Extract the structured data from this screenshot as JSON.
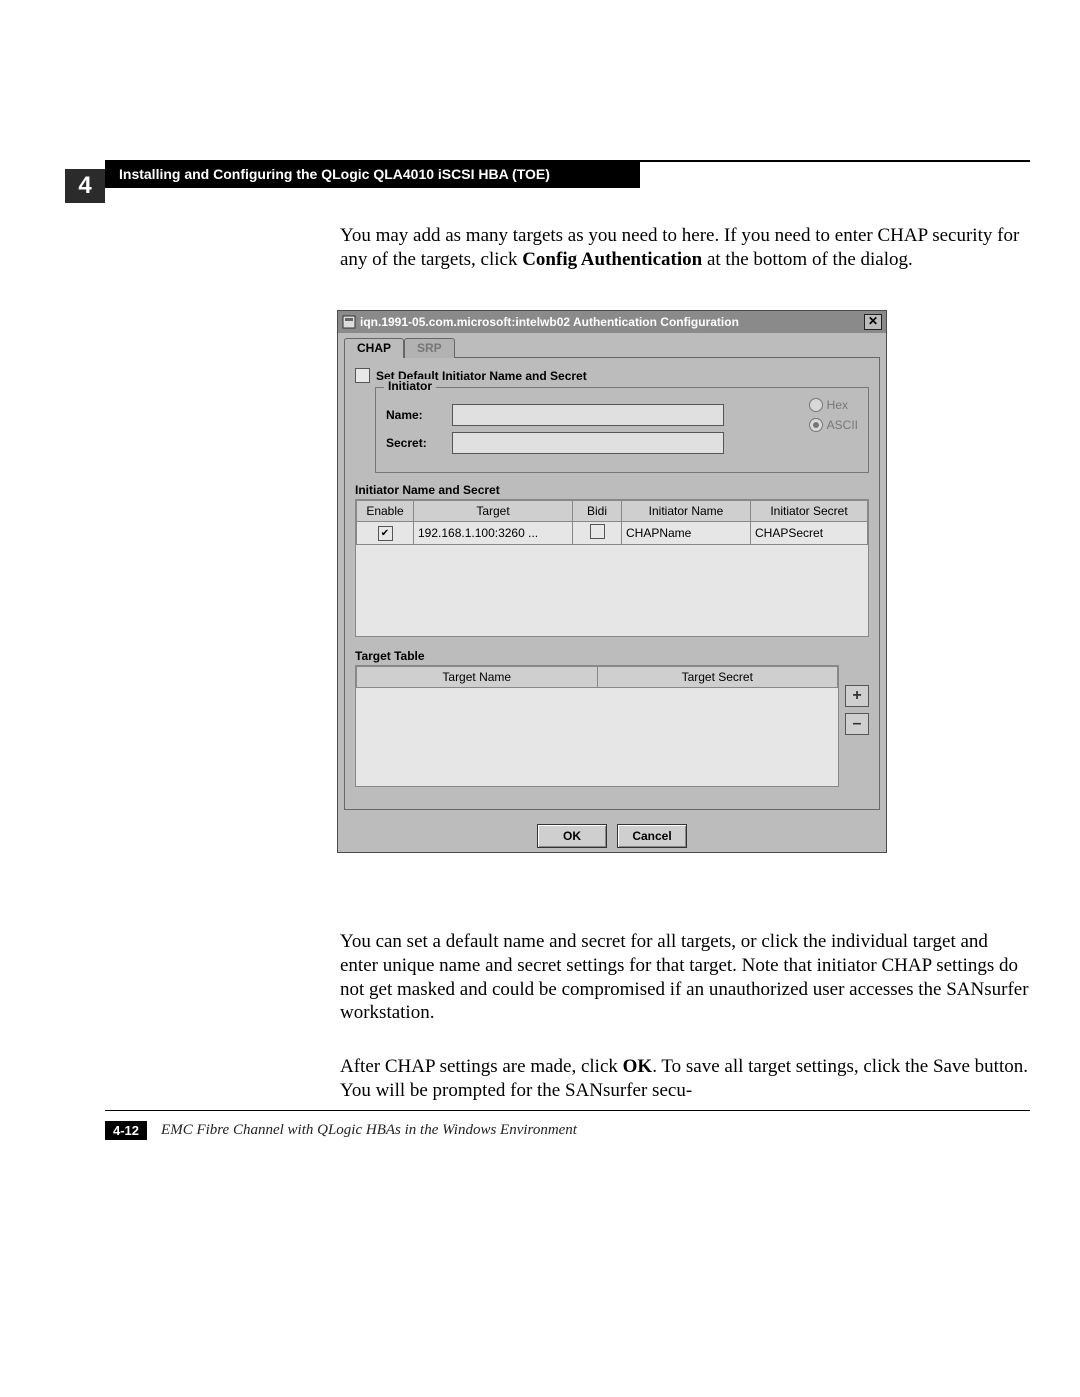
{
  "chapter_number": "4",
  "section_heading": "Installing and Configuring the QLogic QLA4010 iSCSI HBA (TOE)",
  "paragraphs": {
    "p1_a": "You may add as many targets as you need to here.  If you need to enter CHAP security for any of the targets, click ",
    "p1_b": "Config Authentication",
    "p1_c": " at the bottom of the dialog.",
    "p2": "You can set a default name and secret for all targets, or click the individual target and enter unique name and secret settings for that target.  Note that initiator CHAP settings do not get masked and could be compromised if an unauthorized user accesses the SANsurfer workstation.",
    "p3_a": "After CHAP settings are made, click ",
    "p3_b": "OK",
    "p3_c": ".  To save all target settings, click the Save button.  You will be prompted for the SANsurfer secu-"
  },
  "dialog": {
    "title": "iqn.1991-05.com.microsoft:intelwb02 Authentication Configuration",
    "tabs": {
      "chap": "CHAP",
      "srp": "SRP"
    },
    "default_check_label": "Set Default Initiator Name and Secret",
    "initiator_group": {
      "legend": "Initiator",
      "name_label": "Name:",
      "secret_label": "Secret:",
      "name_value": "",
      "secret_value": "",
      "hex_label": "Hex",
      "ascii_label": "ASCII"
    },
    "initiator_table": {
      "title": "Initiator Name and Secret",
      "headers": {
        "enable": "Enable",
        "target": "Target",
        "bidi": "Bidi",
        "initiator_name": "Initiator Name",
        "initiator_secret": "Initiator Secret"
      },
      "rows": [
        {
          "enable": true,
          "target": "192.168.1.100:3260 ...",
          "bidi": false,
          "initiator_name": "CHAPName",
          "initiator_secret": "CHAPSecret"
        }
      ]
    },
    "target_table": {
      "title": "Target Table",
      "headers": {
        "target_name": "Target Name",
        "target_secret": "Target Secret"
      }
    },
    "buttons": {
      "ok": "OK",
      "cancel": "Cancel",
      "add": "+",
      "remove": "–"
    }
  },
  "footer": {
    "page": "4-12",
    "book": "EMC Fibre Channel with QLogic HBAs in the Windows Environment"
  }
}
